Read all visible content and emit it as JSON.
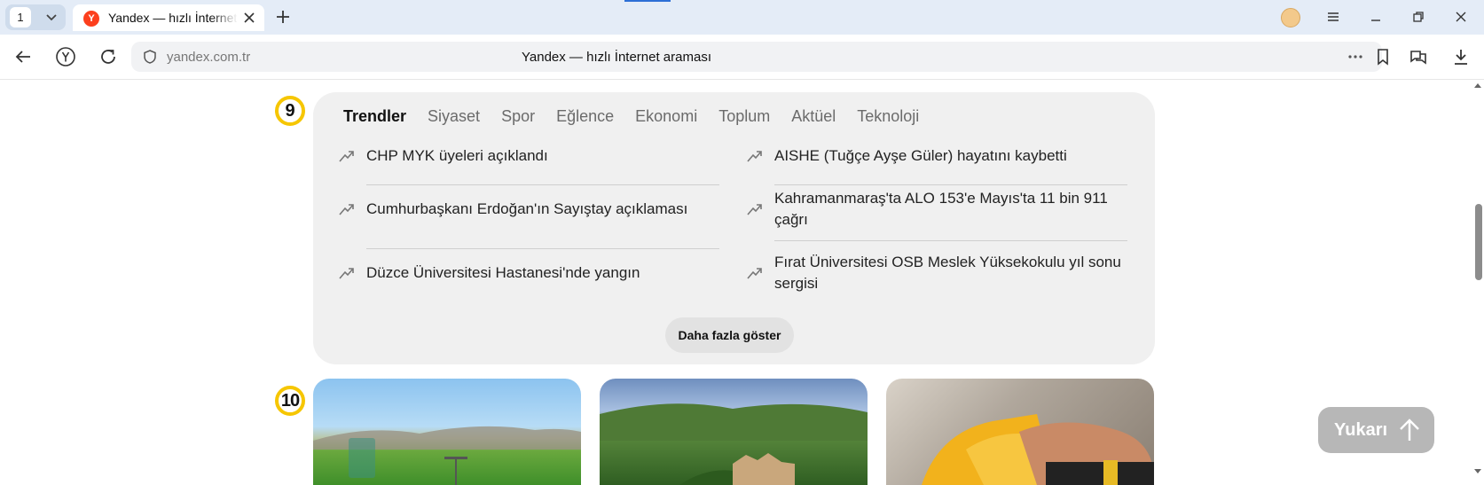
{
  "browser": {
    "tab_count": "1",
    "tab_title": "Yandex — hızlı İnternet araması",
    "tab_favicon_letter": "Y",
    "url": "yandex.com.tr",
    "page_title": "Yandex — hızlı İnternet araması"
  },
  "trends_section": {
    "badge": "9",
    "tabs": [
      "Trendler",
      "Siyaset",
      "Spor",
      "Eğlence",
      "Ekonomi",
      "Toplum",
      "Aktüel",
      "Teknoloji"
    ],
    "active_tab": "Trendler",
    "left_items": [
      "CHP MYK üyeleri açıklandı",
      "Cumhurbaşkanı Erdoğan'ın Sayıştay açıklaması",
      "Düzce Üniversitesi Hastanesi'nde yangın"
    ],
    "right_items": [
      "AISHE (Tuğçe Ayşe Güler) hayatını kaybetti",
      "Kahramanmaraş'ta ALO 153'e Mayıs'ta 11 bin 911 çağrı",
      "Fırat Üniversitesi OSB Meslek Yüksekokulu yıl sonu sergisi"
    ],
    "more_button": "Daha fazla göster"
  },
  "news_section": {
    "badge": "10"
  },
  "scroll_top_button": "Yukarı",
  "colors": {
    "badge_ring": "#f6c600",
    "panel_bg": "#f0f0f0",
    "yandex_red": "#fc3f1d"
  }
}
